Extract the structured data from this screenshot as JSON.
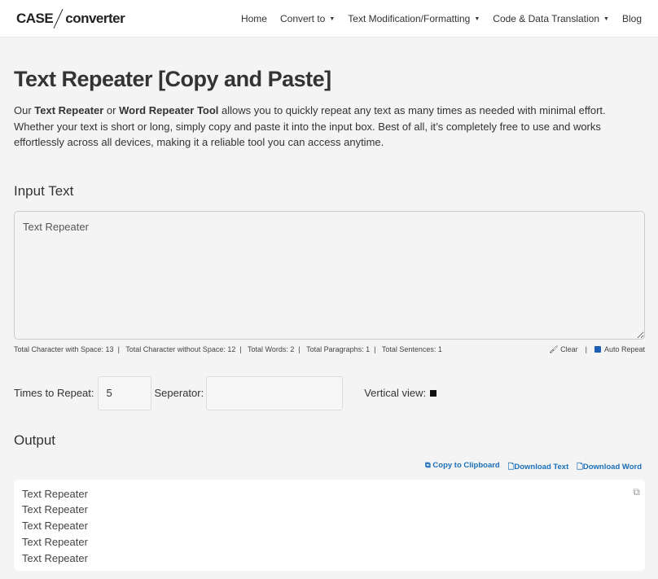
{
  "nav": {
    "logo_left": "CASE",
    "logo_right": "converter",
    "items": [
      {
        "label": "Home",
        "dropdown": false
      },
      {
        "label": "Convert to",
        "dropdown": true
      },
      {
        "label": "Text Modification/Formatting",
        "dropdown": true
      },
      {
        "label": "Code & Data Translation",
        "dropdown": true
      },
      {
        "label": "Blog",
        "dropdown": false
      }
    ]
  },
  "page": {
    "title": "Text Repeater [Copy and Paste]",
    "intro_1": "Our ",
    "intro_b1": "Text Repeater",
    "intro_2": " or ",
    "intro_b2": "Word Repeater Tool",
    "intro_3": " allows you to quickly repeat any text as many times as needed with minimal effort. Whether your text is short or long, simply copy and paste it into the input box. Best of all, it’s completely free to use and works effortlessly across all devices, making it a reliable tool you can access anytime."
  },
  "input": {
    "heading": "Input Text",
    "value": "Text Repeater"
  },
  "stats": [
    "Total Character with Space: 13",
    "Total Character without Space: 12",
    "Total Words: 2",
    "Total Paragraphs: 1",
    "Total Sentences: 1"
  ],
  "tools": {
    "clear": "Clear",
    "auto_repeat": "Auto Repeat",
    "auto_repeat_checked": true
  },
  "controls": {
    "times_label": "Times to Repeat:",
    "times_value": "5",
    "separator_label": "Seperator:",
    "separator_value": "",
    "vertical_label": "Vertical view:",
    "vertical_checked": true
  },
  "output": {
    "heading": "Output",
    "copy": "Copy to Clipboard",
    "download_text": "Download Text",
    "download_word": "Download Word",
    "lines": [
      "Text Repeater",
      "Text Repeater",
      "Text Repeater",
      "Text Repeater",
      "Text Repeater"
    ]
  },
  "colors": {
    "link": "#1a6fb8",
    "background": "#f4f4f4"
  }
}
